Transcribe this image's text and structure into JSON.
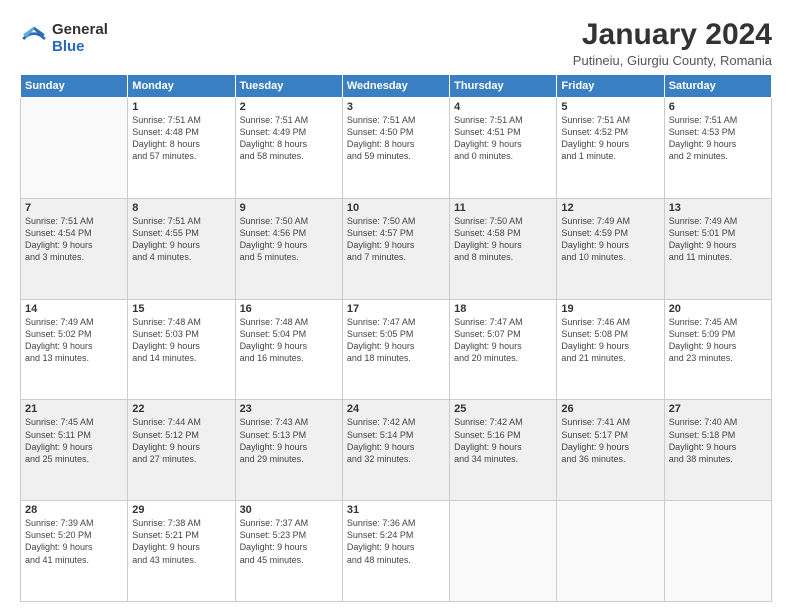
{
  "logo": {
    "general": "General",
    "blue": "Blue"
  },
  "header": {
    "title": "January 2024",
    "location": "Putineiu, Giurgiu County, Romania"
  },
  "weekdays": [
    "Sunday",
    "Monday",
    "Tuesday",
    "Wednesday",
    "Thursday",
    "Friday",
    "Saturday"
  ],
  "weeks": [
    [
      {
        "day": "",
        "info": ""
      },
      {
        "day": "1",
        "info": "Sunrise: 7:51 AM\nSunset: 4:48 PM\nDaylight: 8 hours\nand 57 minutes."
      },
      {
        "day": "2",
        "info": "Sunrise: 7:51 AM\nSunset: 4:49 PM\nDaylight: 8 hours\nand 58 minutes."
      },
      {
        "day": "3",
        "info": "Sunrise: 7:51 AM\nSunset: 4:50 PM\nDaylight: 8 hours\nand 59 minutes."
      },
      {
        "day": "4",
        "info": "Sunrise: 7:51 AM\nSunset: 4:51 PM\nDaylight: 9 hours\nand 0 minutes."
      },
      {
        "day": "5",
        "info": "Sunrise: 7:51 AM\nSunset: 4:52 PM\nDaylight: 9 hours\nand 1 minute."
      },
      {
        "day": "6",
        "info": "Sunrise: 7:51 AM\nSunset: 4:53 PM\nDaylight: 9 hours\nand 2 minutes."
      }
    ],
    [
      {
        "day": "7",
        "info": "Sunrise: 7:51 AM\nSunset: 4:54 PM\nDaylight: 9 hours\nand 3 minutes."
      },
      {
        "day": "8",
        "info": "Sunrise: 7:51 AM\nSunset: 4:55 PM\nDaylight: 9 hours\nand 4 minutes."
      },
      {
        "day": "9",
        "info": "Sunrise: 7:50 AM\nSunset: 4:56 PM\nDaylight: 9 hours\nand 5 minutes."
      },
      {
        "day": "10",
        "info": "Sunrise: 7:50 AM\nSunset: 4:57 PM\nDaylight: 9 hours\nand 7 minutes."
      },
      {
        "day": "11",
        "info": "Sunrise: 7:50 AM\nSunset: 4:58 PM\nDaylight: 9 hours\nand 8 minutes."
      },
      {
        "day": "12",
        "info": "Sunrise: 7:49 AM\nSunset: 4:59 PM\nDaylight: 9 hours\nand 10 minutes."
      },
      {
        "day": "13",
        "info": "Sunrise: 7:49 AM\nSunset: 5:01 PM\nDaylight: 9 hours\nand 11 minutes."
      }
    ],
    [
      {
        "day": "14",
        "info": "Sunrise: 7:49 AM\nSunset: 5:02 PM\nDaylight: 9 hours\nand 13 minutes."
      },
      {
        "day": "15",
        "info": "Sunrise: 7:48 AM\nSunset: 5:03 PM\nDaylight: 9 hours\nand 14 minutes."
      },
      {
        "day": "16",
        "info": "Sunrise: 7:48 AM\nSunset: 5:04 PM\nDaylight: 9 hours\nand 16 minutes."
      },
      {
        "day": "17",
        "info": "Sunrise: 7:47 AM\nSunset: 5:05 PM\nDaylight: 9 hours\nand 18 minutes."
      },
      {
        "day": "18",
        "info": "Sunrise: 7:47 AM\nSunset: 5:07 PM\nDaylight: 9 hours\nand 20 minutes."
      },
      {
        "day": "19",
        "info": "Sunrise: 7:46 AM\nSunset: 5:08 PM\nDaylight: 9 hours\nand 21 minutes."
      },
      {
        "day": "20",
        "info": "Sunrise: 7:45 AM\nSunset: 5:09 PM\nDaylight: 9 hours\nand 23 minutes."
      }
    ],
    [
      {
        "day": "21",
        "info": "Sunrise: 7:45 AM\nSunset: 5:11 PM\nDaylight: 9 hours\nand 25 minutes."
      },
      {
        "day": "22",
        "info": "Sunrise: 7:44 AM\nSunset: 5:12 PM\nDaylight: 9 hours\nand 27 minutes."
      },
      {
        "day": "23",
        "info": "Sunrise: 7:43 AM\nSunset: 5:13 PM\nDaylight: 9 hours\nand 29 minutes."
      },
      {
        "day": "24",
        "info": "Sunrise: 7:42 AM\nSunset: 5:14 PM\nDaylight: 9 hours\nand 32 minutes."
      },
      {
        "day": "25",
        "info": "Sunrise: 7:42 AM\nSunset: 5:16 PM\nDaylight: 9 hours\nand 34 minutes."
      },
      {
        "day": "26",
        "info": "Sunrise: 7:41 AM\nSunset: 5:17 PM\nDaylight: 9 hours\nand 36 minutes."
      },
      {
        "day": "27",
        "info": "Sunrise: 7:40 AM\nSunset: 5:18 PM\nDaylight: 9 hours\nand 38 minutes."
      }
    ],
    [
      {
        "day": "28",
        "info": "Sunrise: 7:39 AM\nSunset: 5:20 PM\nDaylight: 9 hours\nand 41 minutes."
      },
      {
        "day": "29",
        "info": "Sunrise: 7:38 AM\nSunset: 5:21 PM\nDaylight: 9 hours\nand 43 minutes."
      },
      {
        "day": "30",
        "info": "Sunrise: 7:37 AM\nSunset: 5:23 PM\nDaylight: 9 hours\nand 45 minutes."
      },
      {
        "day": "31",
        "info": "Sunrise: 7:36 AM\nSunset: 5:24 PM\nDaylight: 9 hours\nand 48 minutes."
      },
      {
        "day": "",
        "info": ""
      },
      {
        "day": "",
        "info": ""
      },
      {
        "day": "",
        "info": ""
      }
    ]
  ]
}
